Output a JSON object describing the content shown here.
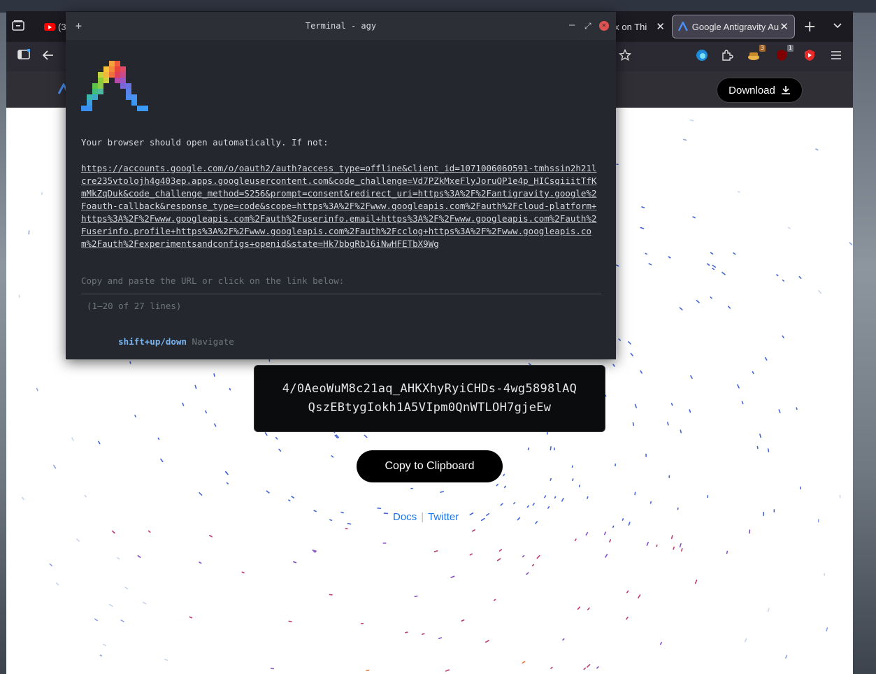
{
  "browser": {
    "tabs": [
      {
        "label": "(3",
        "type": "youtube"
      },
      {
        "label": "ux on Thi",
        "type": "generic"
      },
      {
        "label": "Google Antigravity Au",
        "type": "active"
      }
    ],
    "close_glyph": "✕",
    "new_tab_glyph": "+",
    "toolbar_badges": {
      "extension_count": "3",
      "ublock_count": "1"
    }
  },
  "site": {
    "download_label": "Download"
  },
  "terminal": {
    "title": "Terminal - agy",
    "line_open": "Your browser should open automatically. If not:",
    "url": "https://accounts.google.com/o/oauth2/auth?access_type=offline&client_id=1071006060591-tmhssin2h21lcre235vtolojh4g403ep.apps.googleusercontent.com&code_challenge=Vd7PZkMxeFlyJoruQP1e4p_HICsqiiitTfKmMkZqDuk&code_challenge_method=S256&prompt=consent&redirect_uri=https%3A%2F%2Fantigravity.google%2Foauth-callback&response_type=code&scope=https%3A%2F%2Fwww.googleapis.com%2Fauth%2Fcloud-platform+https%3A%2F%2Fwww.googleapis.com%2Fauth%2Fuserinfo.email+https%3A%2F%2Fwww.googleapis.com%2Fauth%2Fuserinfo.profile+https%3A%2F%2Fwww.googleapis.com%2Fauth%2Fcclog+https%3A%2F%2Fwww.googleapis.com%2Fauth%2Fexperimentsandconfigs+openid&state=Hk7bbgRb16iNwHFETbX9Wg",
    "line_copy": "Copy and paste the URL or click on the link below:",
    "line_count": "(1–20 of 27 lines)",
    "nav_keys": "shift+up/down",
    "nav_label": "Navigate"
  },
  "auth": {
    "code_line1": "4/0AeoWuM8c21aq_AHKXhyRyiCHDs-4wg5898lAQ",
    "code_line2": "QszEBtygIokh1A5VIpm0QnWTLOH7gjeEw",
    "copy_label": "Copy to Clipboard",
    "docs_label": "Docs",
    "twitter_label": "Twitter",
    "separator": "|"
  },
  "colors": {
    "accent_blue": "#1a73e8",
    "terminal_bg": "#24272e",
    "close_red": "#e05252"
  }
}
